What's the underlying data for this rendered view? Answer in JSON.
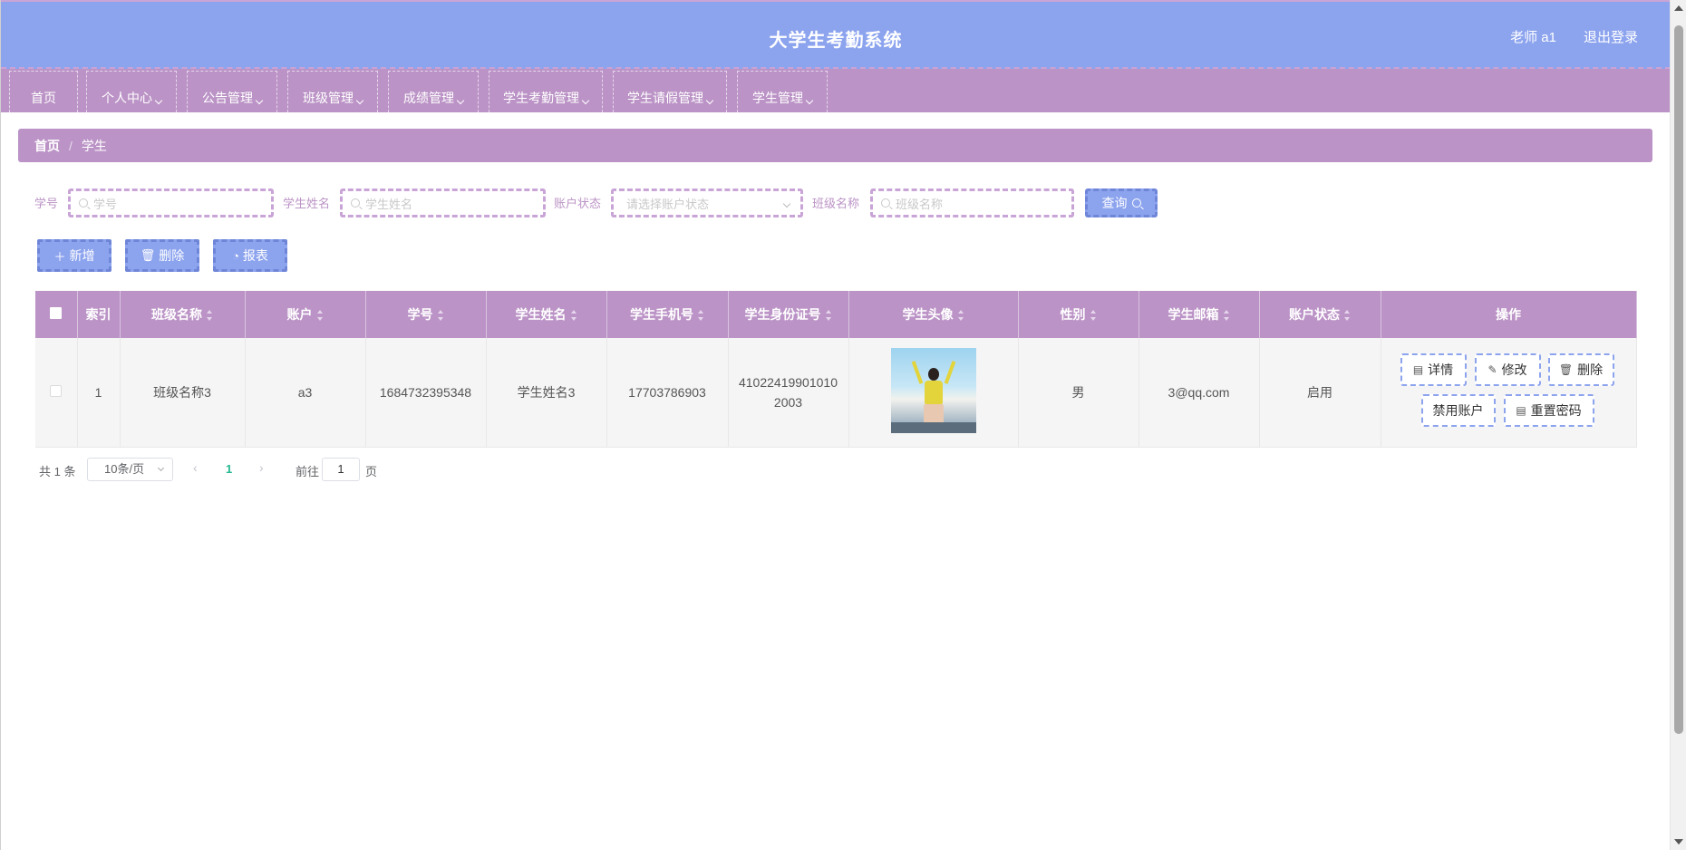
{
  "header": {
    "title": "大学生考勤系统",
    "user": "老师 a1",
    "logout": "退出登录"
  },
  "nav": {
    "items": [
      {
        "label": "首页"
      },
      {
        "label": "个人中心"
      },
      {
        "label": "公告管理"
      },
      {
        "label": "班级管理"
      },
      {
        "label": "成绩管理"
      },
      {
        "label": "学生考勤管理"
      },
      {
        "label": "学生请假管理"
      },
      {
        "label": "学生管理"
      }
    ]
  },
  "breadcrumb": {
    "home": "首页",
    "separator": "/",
    "current": "学生"
  },
  "search": {
    "student_no_label": "学号",
    "student_no_placeholder": "学号",
    "student_name_label": "学生姓名",
    "student_name_placeholder": "学生姓名",
    "account_status_label": "账户状态",
    "account_status_placeholder": "请选择账户状态",
    "class_name_label": "班级名称",
    "class_name_placeholder": "班级名称",
    "query_button": "查询"
  },
  "actions": {
    "add": "新增",
    "delete": "删除",
    "report": "报表"
  },
  "table": {
    "headers": [
      "索引",
      "班级名称",
      "账户",
      "学号",
      "学生姓名",
      "学生手机号",
      "学生身份证号",
      "学生头像",
      "性别",
      "学生邮箱",
      "账户状态",
      "操作"
    ],
    "rows": [
      {
        "index": "1",
        "class_name": "班级名称3",
        "account": "a3",
        "student_no": "1684732395348",
        "student_name": "学生姓名3",
        "phone": "17703786903",
        "id_line1": "41022419901010",
        "id_line2": "2003",
        "gender": "男",
        "email": "3@qq.com",
        "status": "启用",
        "ops": {
          "detail": "详情",
          "edit": "修改",
          "delete": "删除",
          "disable": "禁用账户",
          "reset": "重置密码"
        }
      }
    ]
  },
  "pagination": {
    "total": "共 1 条",
    "page_size": "10条/页",
    "current_page": "1",
    "goto_label": "前往",
    "goto_value": "1",
    "page_suffix": "页"
  },
  "colors": {
    "header": "#8ca3ee",
    "nav": "#bb93c6",
    "accent_green": "#25b891"
  }
}
